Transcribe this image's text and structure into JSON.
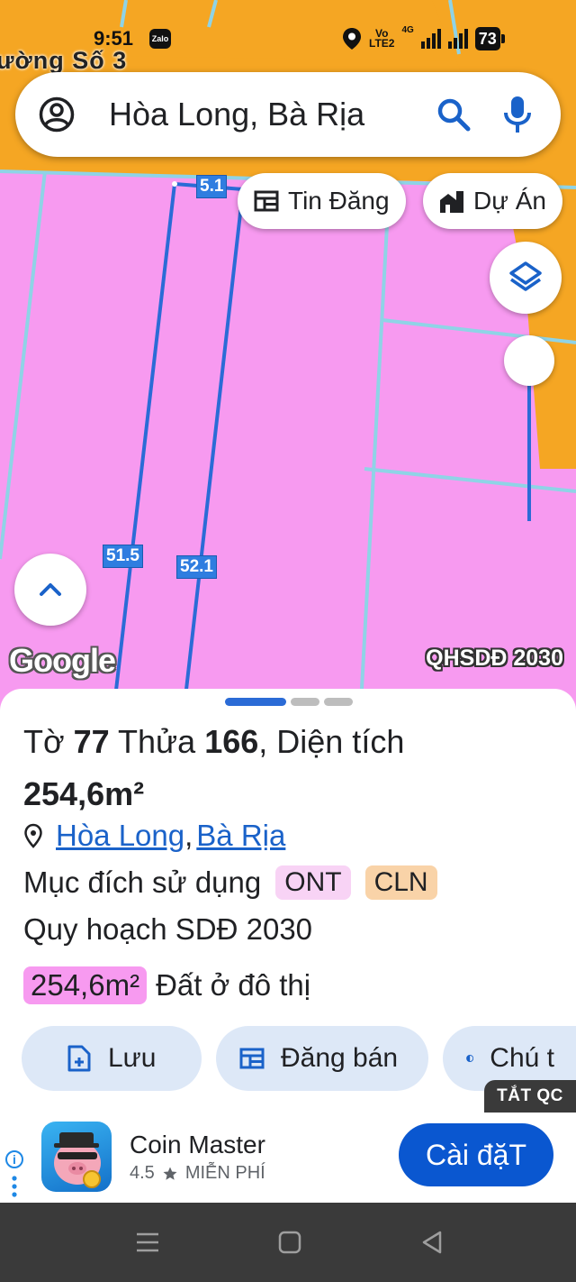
{
  "status_bar": {
    "time": "9:51",
    "zalo": "Zalo",
    "network_top": "Vo",
    "network_bottom": "LTE2",
    "net_type": "4G",
    "battery": "73"
  },
  "map": {
    "road_label": "ường Số 3",
    "parcel_labels": [
      "5.1",
      "51.5",
      "52.1"
    ],
    "google_logo": "Google",
    "plan_tag": "QHSDĐ 2030",
    "colors": {
      "residential": "#f79af0",
      "road": "#f5a623",
      "boundary": "#2b6bd6"
    }
  },
  "search": {
    "query": "Hòa Long, Bà Rịa"
  },
  "chips": {
    "listings": "Tin Đăng",
    "projects": "Dự Án"
  },
  "parcel": {
    "sheet_prefix": "Tờ",
    "sheet_no": "77",
    "plot_prefix": "Thửa",
    "plot_no": "166",
    "area_label": ", Diện tích",
    "area": "254,6m²",
    "ward": "Hòa Long",
    "separator": ",",
    "city": "Bà Rịa",
    "usage_label": "Mục đích sử dụng",
    "usage_tags": [
      "ONT",
      "CLN"
    ],
    "plan_label": "Quy hoạch SDĐ 2030",
    "plan_area": "254,6m²",
    "plan_use": "Đất ở đô thị"
  },
  "actions": {
    "save": "Lưu",
    "post_sale": "Đăng bán",
    "legend": "Chú t"
  },
  "ads_toggle": "TẮT QC",
  "ad": {
    "app_name": "Coin Master",
    "rating": "4.5",
    "price": "MIỄN PHÍ",
    "install": "Cài đặT",
    "brand_color": "#0a57d0"
  }
}
